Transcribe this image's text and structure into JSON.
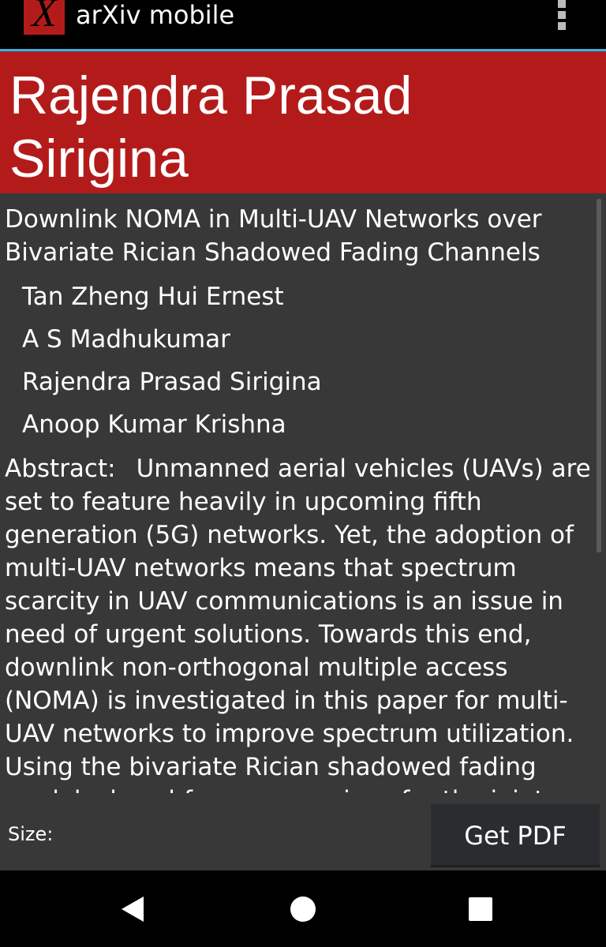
{
  "app": {
    "title": "arXiv mobile",
    "logo_letter": "X",
    "logo_color": "#b31b1b"
  },
  "header": {
    "name": "Rajendra Prasad Sirigina",
    "background_color": "#b31b1b"
  },
  "paper": {
    "title": "Downlink NOMA in Multi-UAV Networks over Bivariate Rician Shadowed Fading Channels",
    "authors": [
      "Tan Zheng Hui Ernest",
      "A S Madhukumar",
      "Rajendra Prasad Sirigina",
      "Anoop Kumar Krishna"
    ],
    "abstract_label": "Abstract:",
    "abstract_text": "Unmanned aerial vehicles (UAVs) are set to feature heavily in upcoming fifth generation (5G) networks. Yet, the adoption of multi-UAV networks means that spectrum scarcity in UAV communications is an issue in need of urgent solutions. Towards this end, downlink non-orthogonal multiple access (NOMA) is investigated in this paper for multi-UAV networks to improve spectrum utilization. Using the bivariate Rician shadowed fading model, closed-form expressions for the joint"
  },
  "footer": {
    "size_label": "Size:",
    "pdf_button": "Get PDF"
  },
  "icons": {
    "overflow": "overflow-menu-icon",
    "back": "back-icon",
    "home": "home-icon",
    "recents": "recents-icon"
  }
}
